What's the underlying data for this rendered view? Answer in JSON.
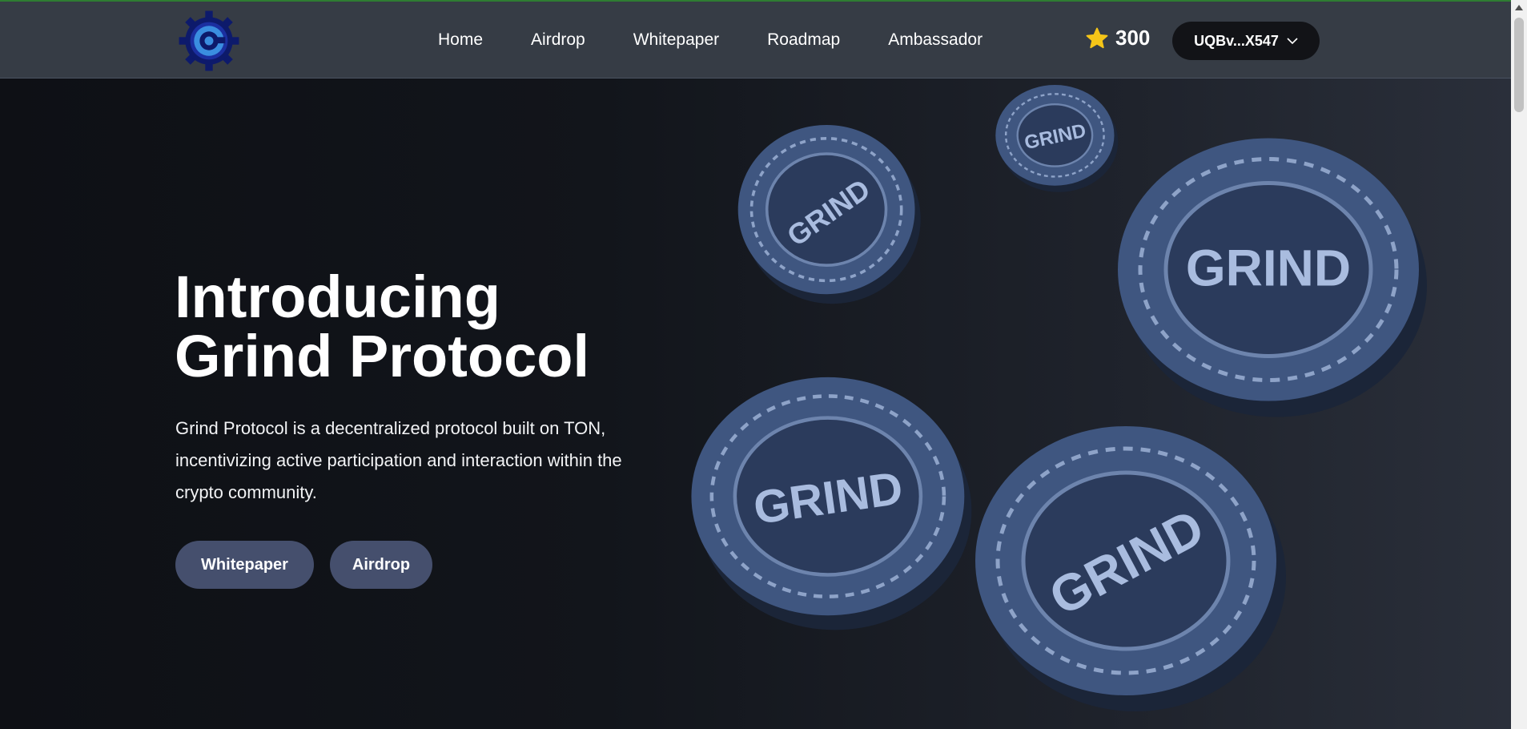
{
  "nav": {
    "logo_letter": "G",
    "links": [
      "Home",
      "Airdrop",
      "Whitepaper",
      "Roadmap",
      "Ambassador"
    ],
    "points": "300",
    "wallet_label": "UQBv...X547"
  },
  "hero": {
    "title_line1": "Introducing",
    "title_line2": "Grind Protocol",
    "description": "Grind Protocol is a decentralized protocol built on TON, incentivizing active participation and interaction within the crypto community.",
    "buttons": {
      "whitepaper": "Whitepaper",
      "airdrop": "Airdrop"
    },
    "coin_text": "GRIND"
  },
  "colors": {
    "navbar": "#363c45",
    "button": "#454f6d",
    "wallet": "#121317",
    "star": "#f5c518",
    "coin": "#3f5680"
  },
  "icons": [
    "gear-logo-icon",
    "star-icon",
    "chevron-down-icon"
  ]
}
